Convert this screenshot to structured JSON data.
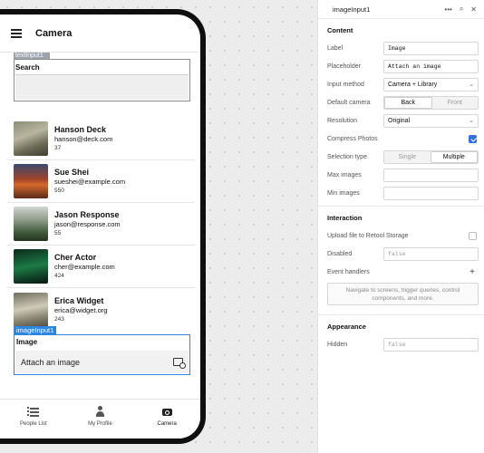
{
  "app": {
    "title": "Camera"
  },
  "search": {
    "tag": "textInput1",
    "label": "Search"
  },
  "people": [
    {
      "name": "Hanson Deck",
      "email": "hanson@deck.com",
      "num": "37"
    },
    {
      "name": "Sue Shei",
      "email": "sueshei@example.com",
      "num": "550"
    },
    {
      "name": "Jason Response",
      "email": "jason@response.com",
      "num": "55"
    },
    {
      "name": "Cher Actor",
      "email": "cher@example.com",
      "num": "424"
    },
    {
      "name": "Erica Widget",
      "email": "erica@widget.org",
      "num": "243"
    }
  ],
  "image_input": {
    "tag": "imageInput1",
    "label": "Image",
    "placeholder": "Attach an image"
  },
  "tabbar": {
    "tabs": [
      {
        "label": "People List",
        "icon": "list-icon"
      },
      {
        "label": "My Profile",
        "icon": "person-icon"
      },
      {
        "label": "Camera",
        "icon": "camera-icon",
        "active": true
      }
    ]
  },
  "inspector": {
    "title": "imageInput1",
    "content": {
      "heading": "Content",
      "label_label": "Label",
      "label_value": "Image",
      "placeholder_label": "Placeholder",
      "placeholder_value": "Attach an image",
      "input_method_label": "Input method",
      "input_method_value": "Camera + Library",
      "default_camera_label": "Default camera",
      "camera_back": "Back",
      "camera_front": "Front",
      "resolution_label": "Resolution",
      "resolution_value": "Original",
      "compress_label": "Compress Photos",
      "compress_checked": true,
      "selection_label": "Selection type",
      "selection_single": "Single",
      "selection_multiple": "Multiple",
      "max_images_label": "Max images",
      "min_images_label": "Min images"
    },
    "interaction": {
      "heading": "Interaction",
      "upload_label": "Upload file to Retool Storage",
      "disabled_label": "Disabled",
      "disabled_value": "false",
      "event_handlers_label": "Event handlers",
      "event_handlers_hint": "Navigate to screens, trigger queries, control components, and more."
    },
    "appearance": {
      "heading": "Appearance",
      "hidden_label": "Hidden",
      "hidden_value": "false"
    }
  }
}
